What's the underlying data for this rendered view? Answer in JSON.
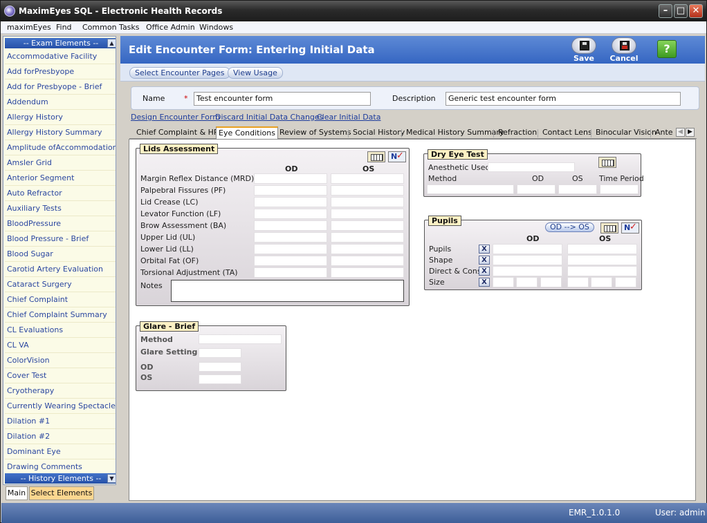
{
  "window": {
    "title": "MaximEyes SQL - Electronic Health Records",
    "min": "–",
    "max": "□",
    "close": "✕"
  },
  "menu": [
    "maximEyes",
    "Find",
    "Common Tasks",
    "Office Admin",
    "Windows"
  ],
  "sidebar": {
    "header": "--  Exam Elements  --",
    "footer_header": "--  History Elements  --",
    "items": [
      "Accommodative Facility",
      "Add forPresbyope",
      "Add for Presbyope - Brief",
      "Addendum",
      "Allergy History",
      "Allergy History Summary",
      "Amplitude ofAccommodation",
      "Amsler Grid",
      "Anterior Segment",
      "Auto Refractor",
      "Auxiliary Tests",
      "BloodPressure",
      "Blood Pressure - Brief",
      "Blood Sugar",
      "Carotid Artery Evaluation",
      "Cataract Surgery",
      "Chief Complaint",
      "Chief Complaint Summary",
      "CL Evaluations",
      "CL VA",
      "ColorVision",
      "Cover Test",
      "Cryotherapy",
      "Currently Wearing Spectacles",
      "Dilation #1",
      "Dilation #2",
      "Dominant Eye",
      "Drawing Comments"
    ],
    "tabs": [
      "Main",
      "Select Elements"
    ]
  },
  "header": {
    "title": "Edit Encounter Form: Entering Initial Data",
    "save": "Save",
    "cancel": "Cancel",
    "help": "?"
  },
  "subbar": {
    "select_pages": "Select Encounter Pages",
    "view_usage": "View Usage"
  },
  "form": {
    "name_label": "Name",
    "required": "*",
    "name_value": "Test encounter form",
    "desc_label": "Description",
    "desc_value": "Generic test encounter form"
  },
  "links": [
    "Design Encounter Form",
    "Discard Initial Data Changes",
    "Clear Initial Data"
  ],
  "tabs": [
    "Chief Complaint & HPI",
    "Eye Conditions",
    "Review of Systems",
    "Social History",
    "Medical History Summary",
    "Refraction",
    "Contact Lens",
    "Binocular Vision",
    "Ante"
  ],
  "lids": {
    "title": "Lids Assessment",
    "od": "OD",
    "os": "OS",
    "rows": [
      "Margin Reflex Distance (MRD)",
      "Palpebral Fissures (PF)",
      "Lid Crease (LC)",
      "Levator Function (LF)",
      "Brow Assessment (BA)",
      "Upper Lid (UL)",
      "Lower Lid (LL)",
      "Orbital Fat (OF)",
      "Torsional Adjustment (TA)"
    ],
    "notes": "Notes"
  },
  "dry_eye": {
    "title": "Dry Eye Test",
    "anesthetic": "Anesthetic Used",
    "method": "Method",
    "od": "OD",
    "os": "OS",
    "time": "Time Period"
  },
  "pupils": {
    "title": "Pupils",
    "btn": "OD --> OS",
    "od": "OD",
    "os": "OS",
    "rows": [
      "Pupils",
      "Shape",
      "Direct & Cons",
      "Size"
    ],
    "x": "X"
  },
  "glare": {
    "title": "Glare - Brief",
    "method": "Method",
    "setting": "Glare Setting",
    "od": "OD",
    "os": "OS"
  },
  "status": {
    "version": "EMR_1.0.1.0",
    "user": "User: admin"
  }
}
